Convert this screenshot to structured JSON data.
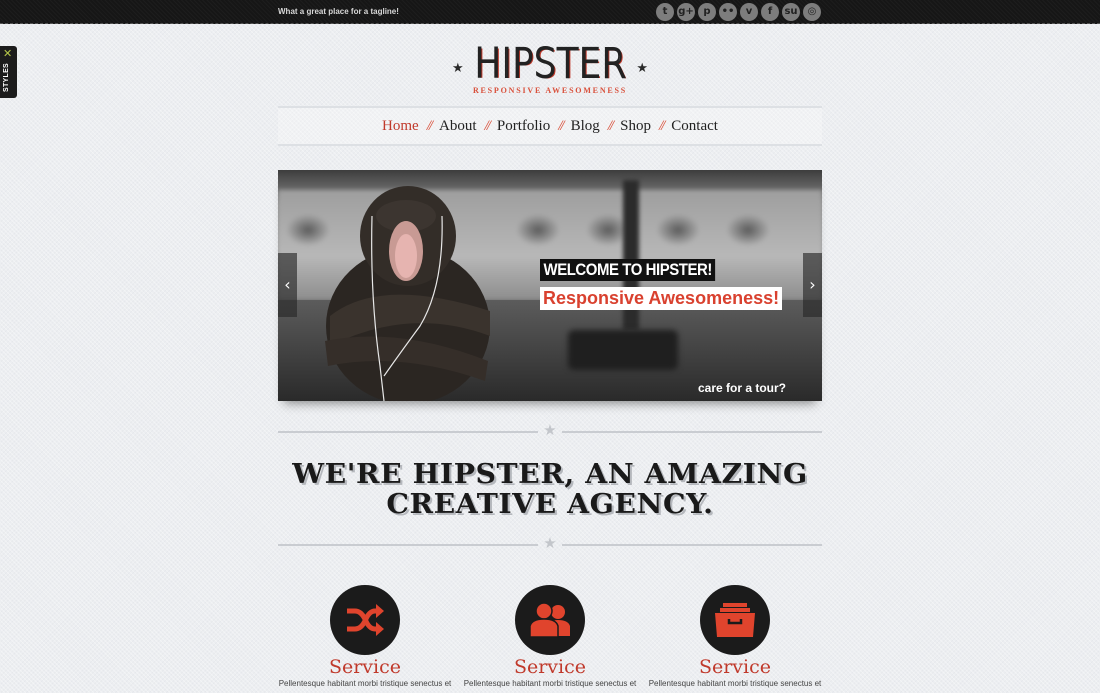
{
  "topbar": {
    "tagline": "What a great place for a tagline!",
    "social": [
      {
        "name": "twitter-icon",
        "glyph": "t"
      },
      {
        "name": "google-plus-icon",
        "glyph": "g+"
      },
      {
        "name": "pinterest-icon",
        "glyph": "p"
      },
      {
        "name": "flickr-icon",
        "glyph": "••"
      },
      {
        "name": "vimeo-icon",
        "glyph": "v"
      },
      {
        "name": "facebook-icon",
        "glyph": "f"
      },
      {
        "name": "stumbleupon-icon",
        "glyph": "su"
      },
      {
        "name": "dribbble-icon",
        "glyph": "◎"
      }
    ]
  },
  "styles_tab": {
    "label": "STYLES",
    "icon": "tools-icon"
  },
  "logo": {
    "word": "HIPSTER",
    "subtitle": "RESPONSIVE AWESOMENESS"
  },
  "nav": {
    "items": [
      {
        "label": "Home",
        "active": true
      },
      {
        "label": "About"
      },
      {
        "label": "Portfolio"
      },
      {
        "label": "Blog"
      },
      {
        "label": "Shop"
      },
      {
        "label": "Contact"
      }
    ],
    "separator": "//"
  },
  "slider": {
    "title": "WELCOME TO HIPSTER!",
    "subtitle": "Responsive Awesomeness!",
    "cta": "care for a tour?",
    "prev": "‹",
    "next": "›"
  },
  "headline": {
    "line1": "We're Hipster, an amazing",
    "line2": "creative agency."
  },
  "services": [
    {
      "icon": "shuffle-icon",
      "title": "Service",
      "desc": "Pellentesque habitant morbi tristique senectus et"
    },
    {
      "icon": "users-icon",
      "title": "Service",
      "desc": "Pellentesque habitant morbi tristique senectus et"
    },
    {
      "icon": "archive-drawer-icon",
      "title": "Service",
      "desc": "Pellentesque habitant morbi tristique senectus et"
    }
  ],
  "colors": {
    "accent": "#c0392b",
    "topbar": "#161616",
    "background": "#eceef1"
  }
}
